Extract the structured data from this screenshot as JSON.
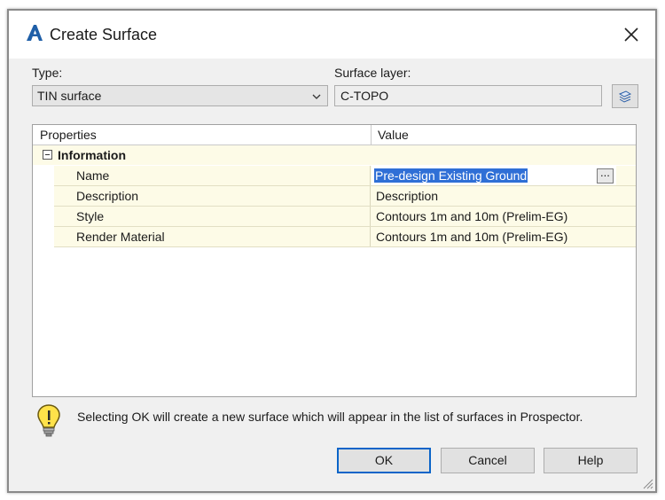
{
  "window": {
    "title": "Create Surface",
    "app_icon": "autocad-a-icon"
  },
  "type": {
    "label": "Type:",
    "value": "TIN surface"
  },
  "surface_layer": {
    "label": "Surface layer:",
    "value": "C-TOPO",
    "button_icon": "layers-icon"
  },
  "grid": {
    "headers": [
      "Properties",
      "Value"
    ],
    "category": "Information",
    "rows": [
      {
        "key": "Name",
        "value": "Pre-design Existing Ground"
      },
      {
        "key": "Description",
        "value": "Description"
      },
      {
        "key": "Style",
        "value": "Contours 1m and 10m (Prelim-EG)"
      },
      {
        "key": "Render Material",
        "value": "Contours 1m and 10m (Prelim-EG)"
      }
    ],
    "ellipsis": "..."
  },
  "info_message": "Selecting OK will create a new surface which will appear in the list of surfaces in Prospector.",
  "buttons": {
    "ok": "OK",
    "cancel": "Cancel",
    "help": "Help"
  },
  "colors": {
    "selection": "#2f6fd6",
    "row_bg": "#fdfbe7",
    "ok_border": "#0a64c8"
  }
}
